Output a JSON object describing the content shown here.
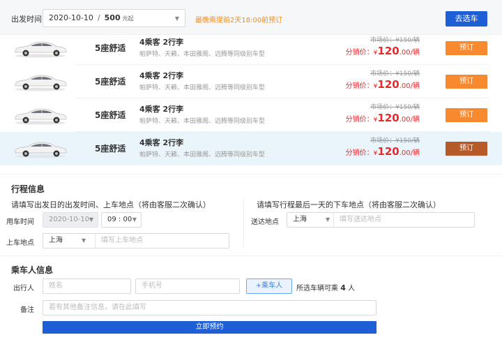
{
  "filter": {
    "label": "出发时间",
    "date": "2020-10-10",
    "separator": "/",
    "price": "500",
    "price_unit": "元起",
    "note": "最晚需提前2天18:00前预订",
    "button": "去选车"
  },
  "cars": [
    {
      "seat": "5座舒适",
      "capacity": "4乘客 2行李",
      "models": "帕萨特、天籁、本田雅阁、迈腾等同级别车型",
      "orig_price": "市场价：¥150/辆",
      "dist_label": "分销价：",
      "currency": "¥",
      "price": "120",
      "price_suffix": ".00/辆",
      "book": "预订"
    },
    {
      "seat": "5座舒适",
      "capacity": "4乘客 2行李",
      "models": "帕萨特、天籁、本田雅阁、迈腾等同级别车型",
      "orig_price": "市场价：¥150/辆",
      "dist_label": "分销价：",
      "currency": "¥",
      "price": "120",
      "price_suffix": ".00/辆",
      "book": "预订"
    },
    {
      "seat": "5座舒适",
      "capacity": "4乘客 2行李",
      "models": "帕萨特、天籁、本田雅阁、迈腾等同级别车型",
      "orig_price": "市场价：¥150/辆",
      "dist_label": "分销价：",
      "currency": "¥",
      "price": "120",
      "price_suffix": ".00/辆",
      "book": "预订"
    },
    {
      "seat": "5座舒适",
      "capacity": "4乘客 2行李",
      "models": "帕萨特、天籁、本田雅阁、迈腾等同级别车型",
      "orig_price": "市场价：¥150/辆",
      "dist_label": "分销价：",
      "currency": "¥",
      "price": "120",
      "price_suffix": ".00/辆",
      "book": "预订"
    }
  ],
  "trip": {
    "title": "行程信息",
    "left_subtitle": "请填写出发日的出发时间、上车地点（将由客服二次确认）",
    "right_subtitle": "请填写行程最后一天的下车地点（将由客服二次确认）",
    "use_time_label": "用车时间",
    "use_date": "2020-10-10",
    "use_time": "09 : 00",
    "pickup_label": "上车地点",
    "pickup_city": "上海",
    "pickup_placeholder": "填写上车地点",
    "dropoff_label": "送达地点",
    "dropoff_city": "上海",
    "dropoff_placeholder": "填写送达地点"
  },
  "passenger": {
    "title": "乘车人信息",
    "traveler_label": "出行人",
    "name_placeholder": "姓名",
    "phone_placeholder": "手机号",
    "add_button": "+乘车人",
    "capacity_prefix": "所选车辆可乘",
    "capacity_count": "4",
    "capacity_suffix": "人",
    "remark_label": "备注",
    "remark_placeholder": "若有其他备注信息，请在此填写"
  },
  "submit": "立即预约",
  "colors": {
    "primary": "#1e5fd6",
    "orange": "#f78a2f",
    "selected_book": "#b65a2a",
    "price_red": "#e8282b",
    "highlight_row": "#eaf4fb"
  }
}
